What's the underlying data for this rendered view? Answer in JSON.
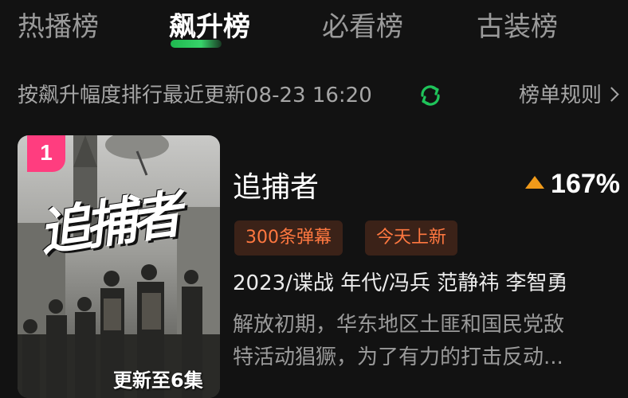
{
  "tabs": [
    {
      "label": "热播榜",
      "active": false
    },
    {
      "label": "飙升榜",
      "active": true
    },
    {
      "label": "必看榜",
      "active": false
    },
    {
      "label": "古装榜",
      "active": false
    }
  ],
  "subbar": {
    "description": "按飙升幅度排行最近更新08-23 16:20",
    "refresh_icon": "refresh-icon",
    "rules_label": "榜单规则",
    "rules_icon": "chevron-right-icon"
  },
  "item": {
    "rank": "1",
    "poster_title": "追捕者",
    "poster_update": "更新至6集",
    "title": "追捕者",
    "trend_icon": "triangle-up-icon",
    "trend_value": "167%",
    "tags": [
      "300条弹幕",
      "今天上新"
    ],
    "meta": "2023/谍战 年代/冯兵 范静祎 李智勇",
    "description_lines": [
      "解放初期，华东地区土匪和国民党敌",
      "特活动猖獗，为了有力的打击反动..."
    ]
  },
  "colors": {
    "background": "#121212",
    "accent_green": "#1fb84f",
    "rank_badge": "#ff3d7f",
    "trend_up": "#f09a1a",
    "tag_text": "#ff7840",
    "tag_bg": "#3b2218"
  }
}
